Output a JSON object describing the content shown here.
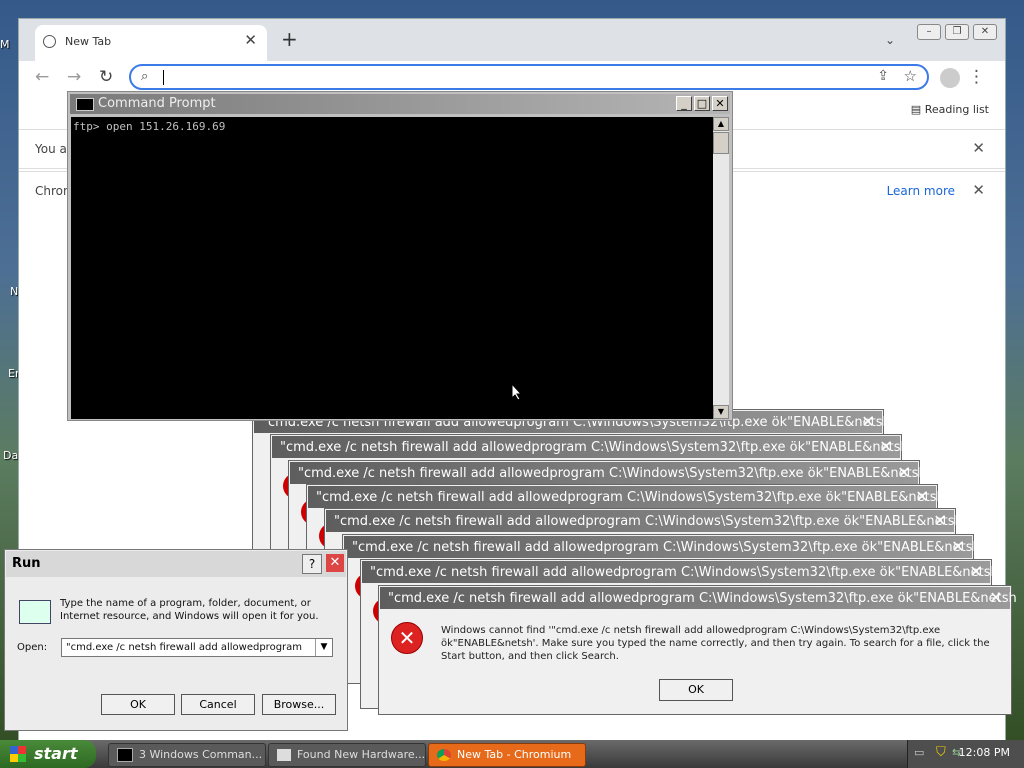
{
  "desktop": {
    "icon_labels": [
      "M",
      "N",
      "Er",
      "Da"
    ]
  },
  "chrome": {
    "tab_title": "New Tab",
    "new_tab_symbol": "+",
    "omnibox_value": "",
    "reading_list": "Reading list",
    "infobar1_text": "You a",
    "infobar2_text": "Chron",
    "learn_more": "Learn more"
  },
  "cmd": {
    "title": "Command Prompt",
    "line": "ftp> open 151.26.169.69"
  },
  "errors": {
    "title": "\"cmd.exe /c netsh firewall add allowedprogram C:\\Windows\\System32\\ftp.exe ök\"ENABLE&netsh",
    "message": "Windows cannot find '\"cmd.exe /c netsh firewall add allowedprogram C:\\Windows\\System32\\ftp.exe ök\"ENABLE&netsh'. Make sure you typed the name correctly, and then try again. To search for a file, click the Start button, and then click Search.",
    "ok": "OK"
  },
  "run": {
    "title": "Run",
    "description": "Type the name of a program, folder, document, or Internet resource, and Windows will open it for you.",
    "open_label": "Open:",
    "open_value": "\"cmd.exe /c netsh firewall add allowedprogram",
    "ok": "OK",
    "cancel": "Cancel",
    "browse": "Browse..."
  },
  "taskbar": {
    "start": "start",
    "tasks": [
      {
        "label": "3 Windows Comman..."
      },
      {
        "label": "Found New Hardware..."
      },
      {
        "label": "New Tab - Chromium"
      }
    ],
    "clock": "12:08 PM"
  },
  "colors": {
    "error_red": "#cc2222",
    "start_green": "#3a7a2e",
    "chromium_blue": "#3b7be8",
    "active_task": "#e66a1a"
  }
}
